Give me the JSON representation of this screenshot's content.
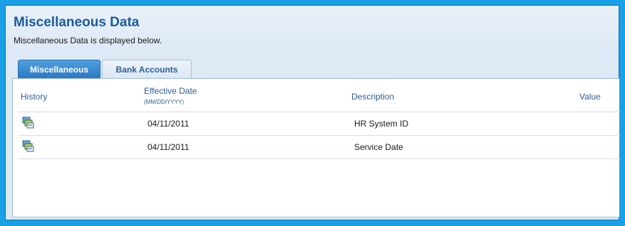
{
  "header": {
    "title": "Miscellaneous Data",
    "subtitle": "Miscellaneous Data is displayed below."
  },
  "tabs": [
    {
      "label": "Miscellaneous",
      "active": true
    },
    {
      "label": "Bank Accounts",
      "active": false
    }
  ],
  "table": {
    "columns": {
      "history": "History",
      "effective_date": "Effective Date",
      "effective_date_format": "(MM/DD/YYYY)",
      "description": "Description",
      "value": "Value"
    },
    "rows": [
      {
        "history_icon": "history-icon",
        "effective_date": "04/11/2011",
        "description": "HR System ID",
        "value": ""
      },
      {
        "history_icon": "history-icon",
        "effective_date": "04/11/2011",
        "description": "Service Date",
        "value": ""
      }
    ]
  },
  "colors": {
    "outer_border": "#1aa0e6",
    "title": "#1b5b9c",
    "active_tab": "#2b79c2",
    "header_text": "#2d5e93"
  }
}
